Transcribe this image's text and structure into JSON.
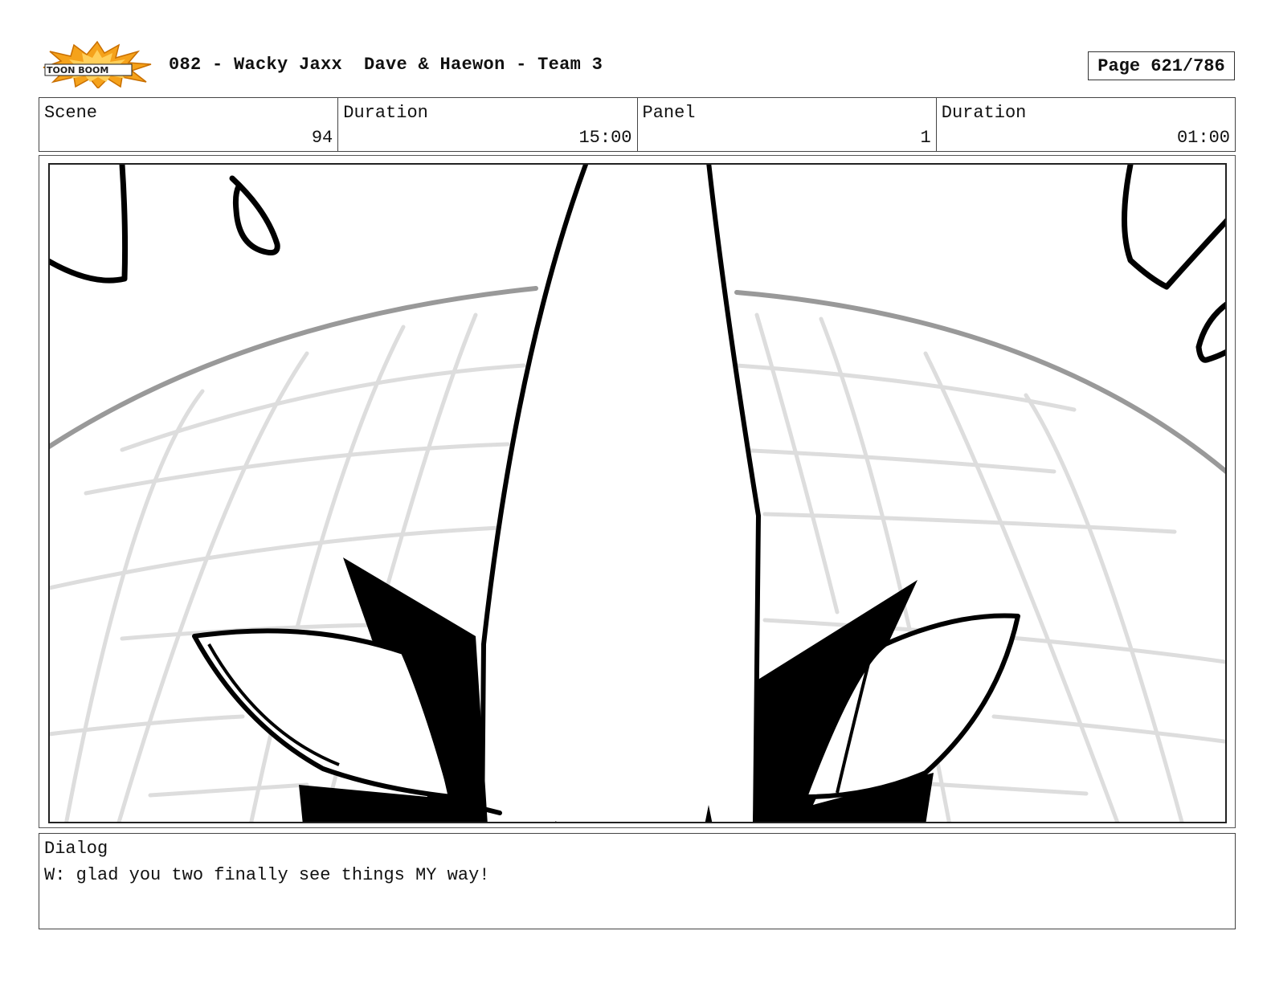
{
  "header": {
    "logo_icon": "toonboom-logo-burst",
    "logo_text": "TOON BOOM",
    "title": "082 - Wacky Jaxx  Dave & Haewon - Team 3",
    "page_label": "Page 621/786"
  },
  "info": {
    "scene_label": "Scene",
    "scene_value": "94",
    "scene_duration_label": "Duration",
    "scene_duration_value": "15:00",
    "panel_label": "Panel",
    "panel_value": "1",
    "panel_duration_label": "Duration",
    "panel_duration_value": "01:00"
  },
  "dialog": {
    "label": "Dialog",
    "text": "W: glad you two finally see things MY way!"
  },
  "colors": {
    "ink": "#000000",
    "grid": "#dddddd",
    "horizon": "#999999",
    "logo_orange": "#f5a21b",
    "logo_dark": "#222222"
  }
}
